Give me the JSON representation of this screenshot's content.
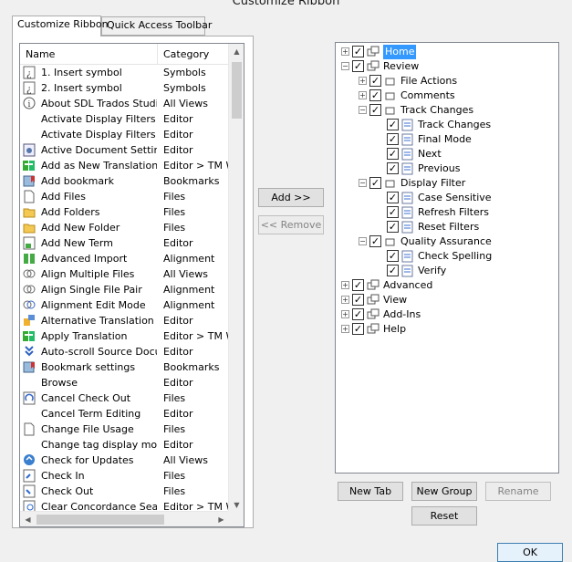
{
  "window": {
    "title": "Customize Ribbon"
  },
  "tabs": [
    {
      "label": "Customize Ribbon",
      "active": true
    },
    {
      "label": "Quick Access Toolbar",
      "active": false
    }
  ],
  "command_list": {
    "columns": [
      "Name",
      "Category"
    ],
    "rows": [
      {
        "name": "1. Insert symbol",
        "category": "Symbols",
        "icon": "symbol-icon"
      },
      {
        "name": "2. Insert symbol",
        "category": "Symbols",
        "icon": "symbol-icon"
      },
      {
        "name": "About SDL Trados Studio",
        "category": "All Views",
        "icon": "info-icon"
      },
      {
        "name": "Activate Display Filters",
        "category": "Editor",
        "icon": ""
      },
      {
        "name": "Activate Display Filters S...",
        "category": "Editor",
        "icon": ""
      },
      {
        "name": "Active Document Settings",
        "category": "Editor",
        "icon": "settings-icon"
      },
      {
        "name": "Add as New Translation",
        "category": "Editor > TM W",
        "icon": "translation-icon"
      },
      {
        "name": "Add bookmark",
        "category": "Bookmarks",
        "icon": "bookmark-icon"
      },
      {
        "name": "Add Files",
        "category": "Files",
        "icon": "file-icon"
      },
      {
        "name": "Add Folders",
        "category": "Files",
        "icon": "folder-icon"
      },
      {
        "name": "Add New Folder",
        "category": "Files",
        "icon": "folder-icon"
      },
      {
        "name": "Add New Term",
        "category": "Editor",
        "icon": "term-icon"
      },
      {
        "name": "Advanced Import",
        "category": "Alignment",
        "icon": "import-icon"
      },
      {
        "name": "Align Multiple Files",
        "category": "All Views",
        "icon": "align-icon"
      },
      {
        "name": "Align Single File Pair",
        "category": "Alignment",
        "icon": "align-icon"
      },
      {
        "name": "Alignment Edit Mode",
        "category": "Alignment",
        "icon": "align-edit-icon"
      },
      {
        "name": "Alternative Translation L...",
        "category": "Editor",
        "icon": "alt-translation-icon"
      },
      {
        "name": "Apply Translation",
        "category": "Editor > TM W",
        "icon": "translation-icon"
      },
      {
        "name": "Auto-scroll Source Docu...",
        "category": "Editor",
        "icon": "autoscroll-icon"
      },
      {
        "name": "Bookmark settings",
        "category": "Bookmarks",
        "icon": "bookmark-icon"
      },
      {
        "name": "Browse",
        "category": "Editor",
        "icon": ""
      },
      {
        "name": "Cancel Check Out",
        "category": "Files",
        "icon": "cancel-checkout-icon"
      },
      {
        "name": "Cancel Term Editing",
        "category": "Editor",
        "icon": ""
      },
      {
        "name": "Change File Usage",
        "category": "Files",
        "icon": "file-icon"
      },
      {
        "name": "Change tag display mode",
        "category": "Editor",
        "icon": ""
      },
      {
        "name": "Check for Updates",
        "category": "All Views",
        "icon": "update-icon"
      },
      {
        "name": "Check In",
        "category": "Files",
        "icon": "checkin-icon"
      },
      {
        "name": "Check Out",
        "category": "Files",
        "icon": "checkout-icon"
      },
      {
        "name": "Clear Concordance Sear...",
        "category": "Editor > TM W",
        "icon": "concordance-icon"
      }
    ]
  },
  "middle_buttons": {
    "add": "Add >>",
    "remove": "<< Remove"
  },
  "tree": {
    "nodes": [
      {
        "label": "Home",
        "level": 0,
        "expander": "+",
        "selected": true
      },
      {
        "label": "Review",
        "level": 0,
        "expander": "-"
      },
      {
        "label": "File Actions",
        "level": 1,
        "expander": "+"
      },
      {
        "label": "Comments",
        "level": 1,
        "expander": "+"
      },
      {
        "label": "Track Changes",
        "level": 1,
        "expander": "-"
      },
      {
        "label": "Track Changes",
        "level": 2,
        "expander": ""
      },
      {
        "label": "Final Mode",
        "level": 2,
        "expander": ""
      },
      {
        "label": "Next",
        "level": 2,
        "expander": ""
      },
      {
        "label": "Previous",
        "level": 2,
        "expander": ""
      },
      {
        "label": "Display Filter",
        "level": 1,
        "expander": "-"
      },
      {
        "label": "Case Sensitive",
        "level": 2,
        "expander": ""
      },
      {
        "label": "Refresh Filters",
        "level": 2,
        "expander": ""
      },
      {
        "label": "Reset Filters",
        "level": 2,
        "expander": ""
      },
      {
        "label": "Quality Assurance",
        "level": 1,
        "expander": "-"
      },
      {
        "label": "Check Spelling",
        "level": 2,
        "expander": ""
      },
      {
        "label": "Verify",
        "level": 2,
        "expander": ""
      },
      {
        "label": "Advanced",
        "level": 0,
        "expander": "+"
      },
      {
        "label": "View",
        "level": 0,
        "expander": "+"
      },
      {
        "label": "Add-Ins",
        "level": 0,
        "expander": "+"
      },
      {
        "label": "Help",
        "level": 0,
        "expander": "+"
      }
    ]
  },
  "tree_buttons": {
    "new_tab": "New Tab",
    "new_group": "New Group",
    "rename": "Rename",
    "reset": "Reset"
  },
  "dialog_buttons": {
    "ok": "OK"
  },
  "colors": {
    "selection": "#3399ff",
    "accent": "#3c7fb1"
  }
}
